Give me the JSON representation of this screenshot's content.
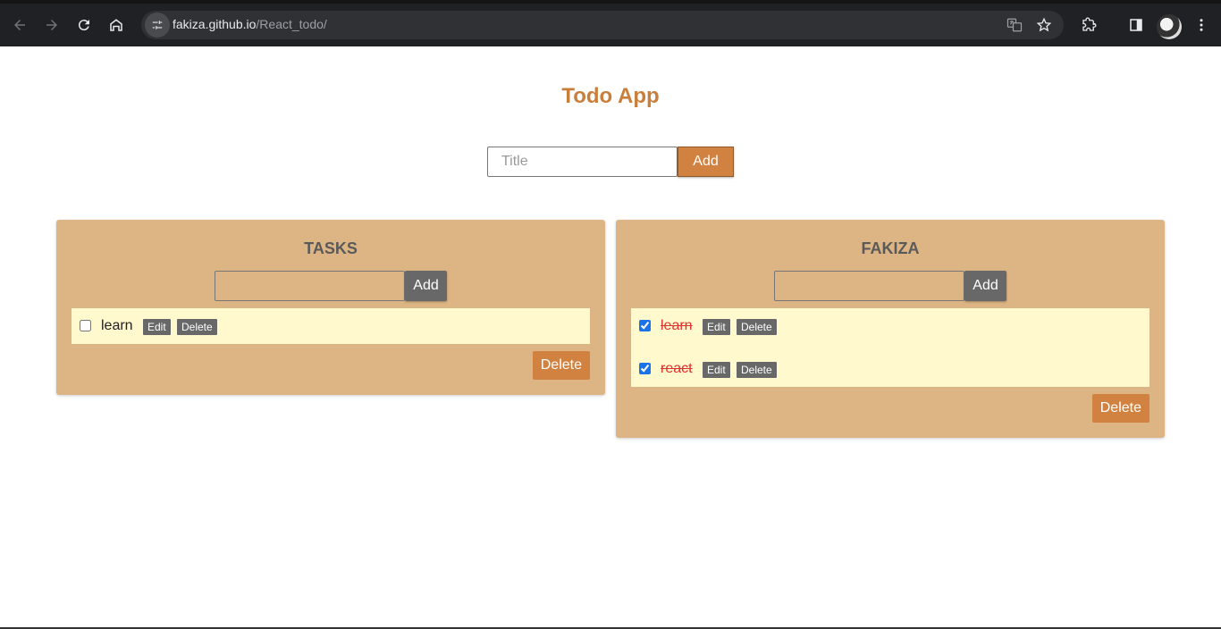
{
  "browser": {
    "url_domain": "fakiza.github.io",
    "url_path": "/React_todo/"
  },
  "app": {
    "title": "Todo App",
    "input_placeholder": "Title",
    "add_label": "Add"
  },
  "lists": [
    {
      "title": "TASKS",
      "add_label": "Add",
      "delete_label": "Delete",
      "items": [
        {
          "text": "learn",
          "checked": false,
          "edit_label": "Edit",
          "delete_label": "Delete"
        }
      ]
    },
    {
      "title": "FAKIZA",
      "add_label": "Add",
      "delete_label": "Delete",
      "items": [
        {
          "text": "learn",
          "checked": true,
          "edit_label": "Edit",
          "delete_label": "Delete"
        },
        {
          "text": "react",
          "checked": true,
          "edit_label": "Edit",
          "delete_label": "Delete"
        }
      ]
    }
  ],
  "colors": {
    "accent": "#d18240",
    "card_bg": "#ddb584",
    "list_bg": "#fff9cd",
    "title": "#c97f3b",
    "done_text": "#e03030"
  }
}
